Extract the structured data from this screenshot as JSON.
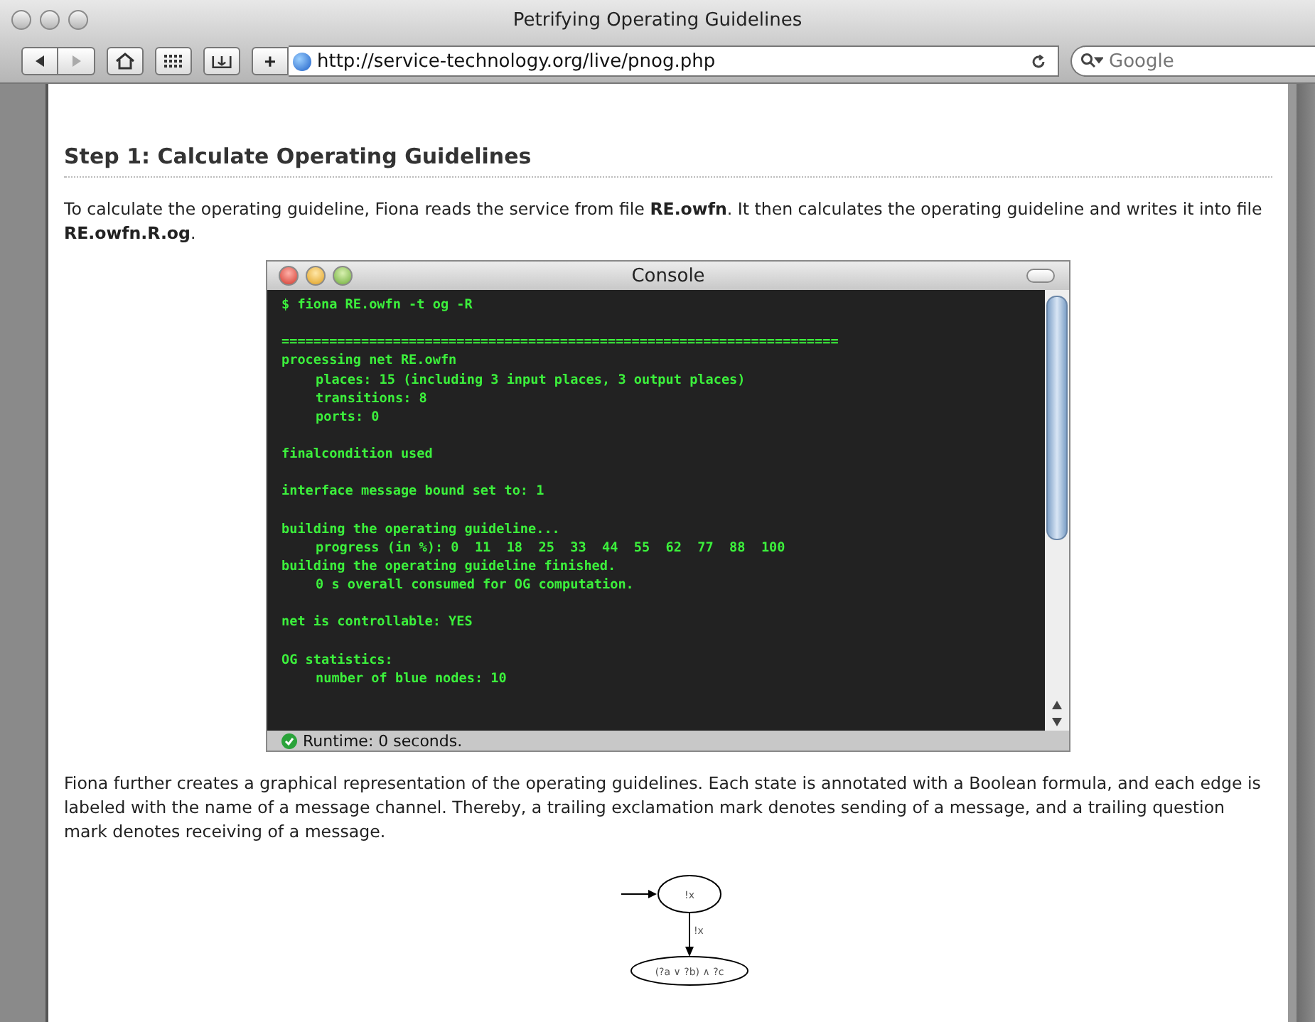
{
  "window": {
    "title": "Petrifying Operating Guidelines"
  },
  "toolbar": {
    "url": "http://service-technology.org/live/pnog.php",
    "search": {
      "placeholder": "Google"
    },
    "nav": [
      {
        "kind": "back",
        "disabled": false
      },
      {
        "kind": "forward",
        "disabled": true
      }
    ],
    "buttons": [
      {
        "kind": "home"
      },
      {
        "kind": "grid"
      },
      {
        "kind": "tray"
      }
    ],
    "add_button": "+"
  },
  "page": {
    "heading": "Step 1: Calculate Operating Guidelines",
    "intro": "To calculate the operating guideline, Fiona reads the service from file **RE.owfn**. It then calculates the operating guideline and writes it into file **RE.owfn.R.og**.",
    "console": {
      "title": "Console",
      "status": "Runtime: 0 seconds.",
      "blocks": [
        [
          {
            "text": "$ fiona RE.owfn -t og -R"
          }
        ],
        [
          {
            "text": "======================================================================"
          },
          {
            "text": "processing net RE.owfn",
            "children": [
              {
                "text": "places: 15 (including 3 input places, 3 output places)"
              },
              {
                "text": "transitions: 8"
              },
              {
                "text": "ports: 0"
              }
            ]
          }
        ],
        [
          {
            "text": "finalcondition used"
          }
        ],
        [
          {
            "text": "interface message bound set to: 1"
          }
        ],
        [
          {
            "text": "building the operating guideline...",
            "children": [
              {
                "text": "progress (in %): 0  11  18  25  33  44  55  62  77  88  100"
              }
            ]
          },
          {
            "text": "building the operating guideline finished.",
            "children": [
              {
                "text": "0 s overall consumed for OG computation."
              }
            ]
          }
        ],
        [
          {
            "text": "net is controllable: YES"
          }
        ],
        [
          {
            "text": "OG statistics:",
            "children": [
              {
                "text": "number of blue nodes: 10"
              }
            ]
          }
        ]
      ]
    },
    "description": "Fiona further creates a graphical representation of the operating guidelines. Each state is annotated with a Boolean formula, and each edge is labeled with the name of a message channel. Thereby, a trailing exclamation mark denotes sending of a message, and a trailing question mark denotes receiving of a message.",
    "graph": {
      "nodes": [
        "!x",
        "(?a ∨ ?b) ∧ ?c"
      ],
      "edge_label": "!x"
    }
  }
}
